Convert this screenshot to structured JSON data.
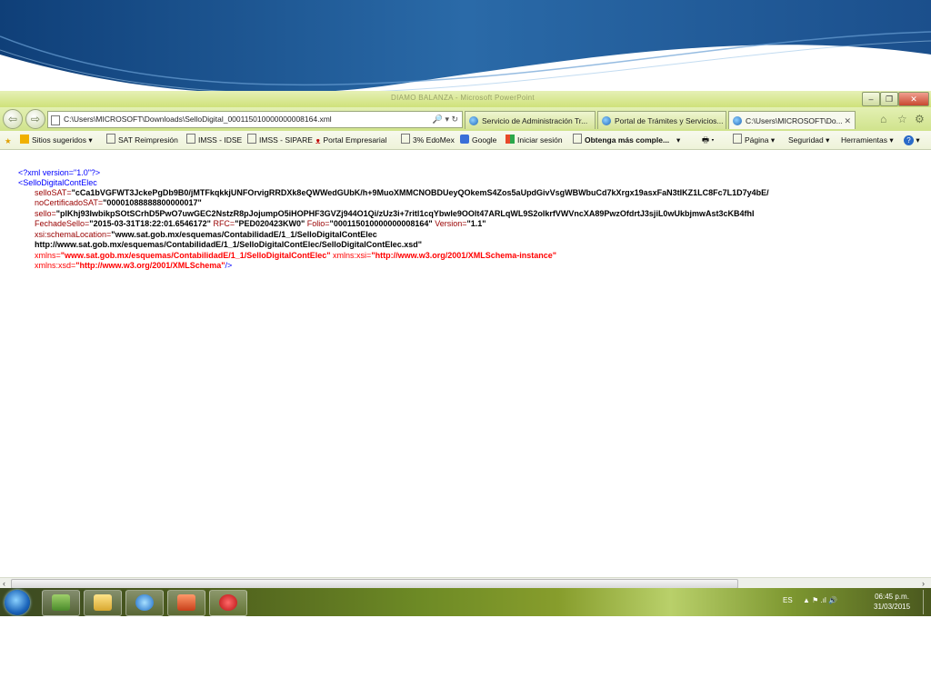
{
  "window": {
    "title": "DIAMO BALANZA - Microsoft PowerPoint"
  },
  "browser": {
    "address": "C:\\Users\\MICROSOFT\\Downloads\\SelloDigital_000115010000000008164.xml",
    "address_controls": "🔎 ▾ ↻",
    "tabs": [
      {
        "label": "Servicio de Administración Tr..."
      },
      {
        "label": "Portal de Trámites y Servicios..."
      },
      {
        "label": "C:\\Users\\MICROSOFT\\Do..."
      }
    ],
    "tab_close": "✕"
  },
  "favorites": {
    "items": [
      "Sitios sugeridos ▾",
      "SAT Reimpresión",
      "IMSS - IDSE",
      "IMSS - SIPARE",
      "Portal Empresarial",
      "3% EdoMex",
      "Google",
      "Iniciar sesión",
      "Obtenga más comple...",
      "▾"
    ],
    "commands": [
      "Página ▾",
      "Seguridad ▾",
      "Herramientas ▾"
    ]
  },
  "xml": {
    "declaration": "<?xml version=\"1.0\"?>",
    "root_open": "<SelloDigitalContElec",
    "selloSAT_name": "selloSAT=",
    "selloSAT_value": "\"cCa1bVGFWT3JckePgDb9B0/jMTFkqkkjUNFOrvigRRDXk8eQWWedGUbK/h+9MuoXMMCNOBDUeyQOkemS4Zos5aUpdGivVsgWBWbuCd7kXrgx19asxFaN3tIKZ1LC8Fc7L1D7y4bE/",
    "noCert_name": "noCertificadoSAT=",
    "noCert_value": "\"00001088888800000017\"",
    "sello_name": "sello=",
    "sello_value": "\"plKhj93IwbikpSOtSCrhD5PwO7uwGEC2NstzR8pJojumpO5iHOPHF3GVZj944O1Qi/zUz3i+7ritl1cqYbwle9OOlt47ARLqWL9S2oIkrfVWVncXA89PwzOfdrtJ3sjiL0wUkbjmwAst3cKB4fhI",
    "fecha_name": "FechadeSello=",
    "fecha_value": "\"2015-03-31T18:22:01.6546172\"",
    "rfc_name": " RFC=",
    "rfc_value": "\"PED020423KW0\"",
    "folio_name": " Folio=",
    "folio_value": "\"000115010000000008164\"",
    "version_name": " Version=",
    "version_value": "\"1.1\"",
    "schema_name": "xsi:schemaLocation=",
    "schema_value1": "\"www.sat.gob.mx/esquemas/ContabilidadE/1_1/SelloDigitalContElec",
    "schema_value2": "http://www.sat.gob.mx/esquemas/ContabilidadE/1_1/SelloDigitalContElec/SelloDigitalContElec.xsd\"",
    "xmlns_name": "xmlns=",
    "xmlns_value": "\"www.sat.gob.mx/esquemas/ContabilidadE/1_1/SelloDigitalContElec\"",
    "xmlns_xsi_name": " xmlns:xsi=",
    "xmlns_xsi_value": "\"http://www.w3.org/2001/XMLSchema-instance\"",
    "xmlns_xsd_name": "xmlns:xsd=",
    "xmlns_xsd_value": "\"http://www.w3.org/2001/XMLSchema\"",
    "close": "/>"
  },
  "taskbar": {
    "lang": "ES",
    "tray_icons": "▲  ⚑  .ıl  🔊",
    "time": "06:45 p.m.",
    "date": "31/03/2015"
  },
  "colors": {
    "slide_blue": "#1f5e9e",
    "chrome_green": "#d0e38c",
    "xml_blue": "#0000ff",
    "xml_red": "#ff0000",
    "xml_dark_red": "#990000"
  }
}
